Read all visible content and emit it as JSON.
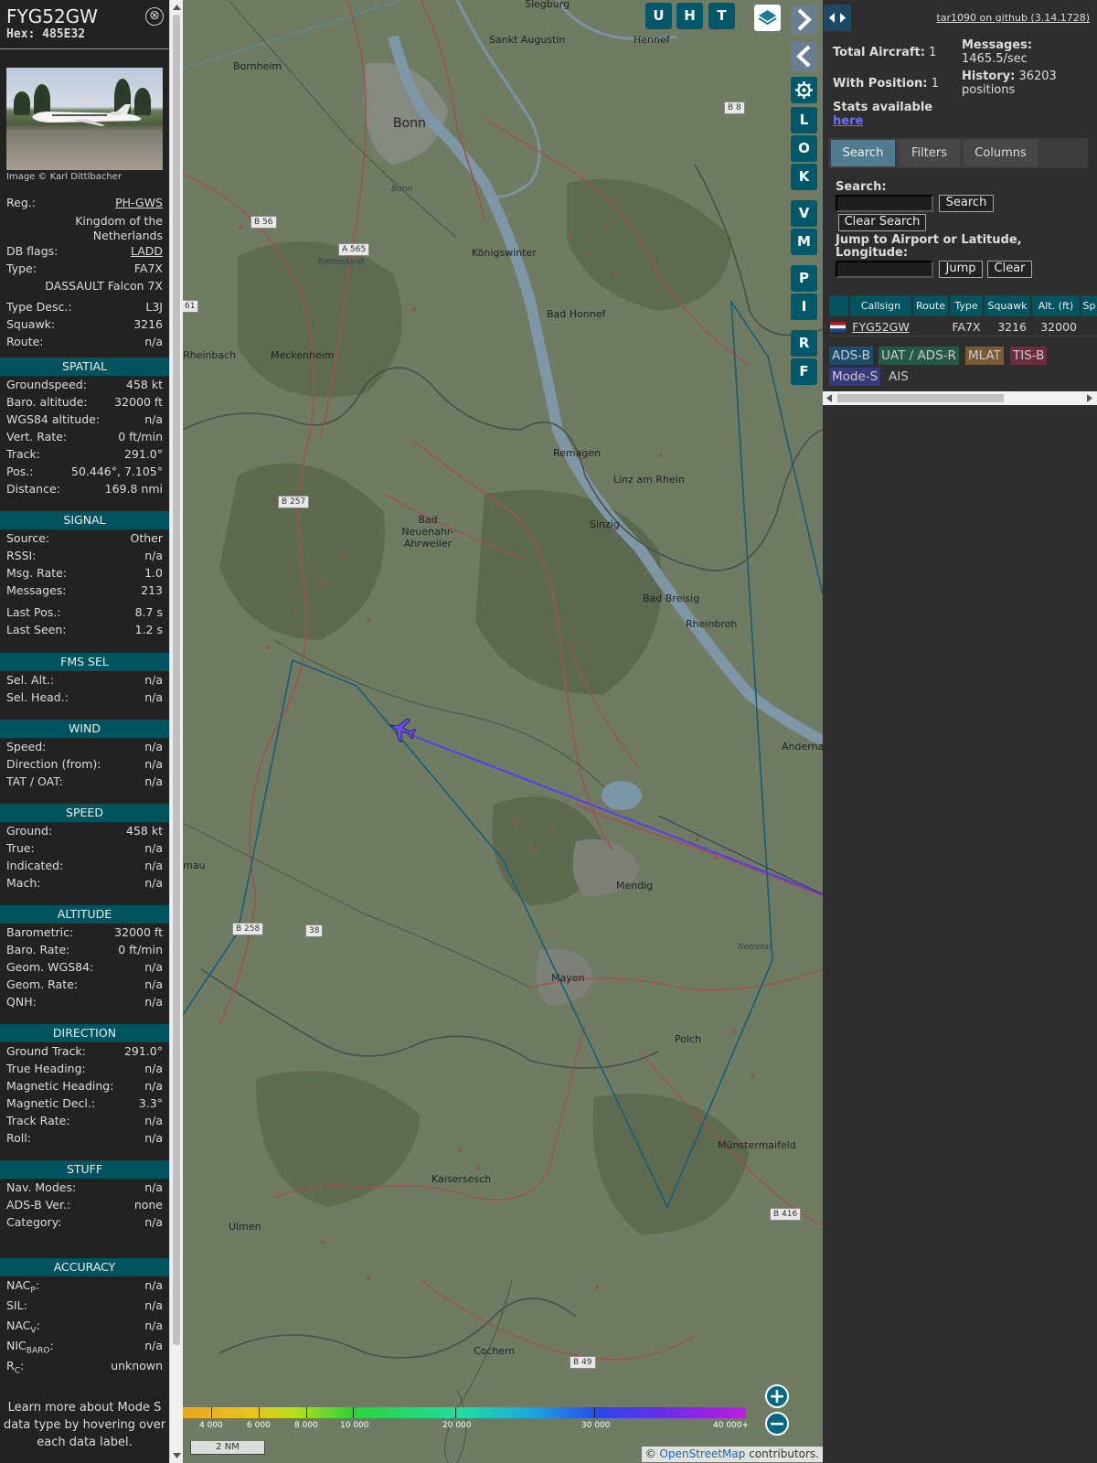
{
  "info": {
    "callsign": "FYG52GW",
    "hex": "Hex: 485E32",
    "close": "⊗",
    "photo_credit": "Image © Karl Dittlbacher",
    "reg": {
      "label": "Reg.:",
      "value": "PH-GWS",
      "country": "Kingdom of the Netherlands"
    },
    "dbflags": {
      "label": "DB flags:",
      "value": "LADD"
    },
    "type": {
      "label": "Type:",
      "value": "FA7X",
      "desc": "DASSAULT Falcon 7X"
    },
    "typedesc": {
      "label": "Type Desc.:",
      "value": "L3J"
    },
    "squawk": {
      "label": "Squawk:",
      "value": "3216"
    },
    "route": {
      "label": "Route:",
      "value": "n/a"
    },
    "sections": {
      "spatial": "SPATIAL",
      "signal": "SIGNAL",
      "fms": "FMS SEL",
      "wind": "WIND",
      "speed": "SPEED",
      "altitude": "ALTITUDE",
      "direction": "DIRECTION",
      "stuff": "STUFF",
      "accuracy": "ACCURACY"
    },
    "spatial": [
      {
        "k": "Groundspeed:",
        "v": "458 kt"
      },
      {
        "k": "Baro. altitude:",
        "v": "32000 ft"
      },
      {
        "k": "WGS84 altitude:",
        "v": "n/a"
      },
      {
        "k": "Vert. Rate:",
        "v": "0 ft/min"
      },
      {
        "k": "Track:",
        "v": "291.0°"
      },
      {
        "k": "Pos.:",
        "v": "50.446°, 7.105°"
      },
      {
        "k": "Distance:",
        "v": "169.8 nmi"
      }
    ],
    "signal": [
      {
        "k": "Source:",
        "v": "Other"
      },
      {
        "k": "RSSI:",
        "v": "n/a"
      },
      {
        "k": "Msg. Rate:",
        "v": "1.0"
      },
      {
        "k": "Messages:",
        "v": "213"
      },
      {
        "k": "Last Pos.:",
        "v": "8.7 s"
      },
      {
        "k": "Last Seen:",
        "v": "1.2 s"
      }
    ],
    "fms": [
      {
        "k": "Sel. Alt.:",
        "v": "n/a"
      },
      {
        "k": "Sel. Head.:",
        "v": "n/a"
      }
    ],
    "wind": [
      {
        "k": "Speed:",
        "v": "n/a"
      },
      {
        "k": "Direction (from):",
        "v": "n/a"
      },
      {
        "k": "TAT / OAT:",
        "v": "n/a"
      }
    ],
    "speed": [
      {
        "k": "Ground:",
        "v": "458 kt"
      },
      {
        "k": "True:",
        "v": "n/a"
      },
      {
        "k": "Indicated:",
        "v": "n/a"
      },
      {
        "k": "Mach:",
        "v": "n/a"
      }
    ],
    "altitude": [
      {
        "k": "Barometric:",
        "v": "32000 ft"
      },
      {
        "k": "Baro. Rate:",
        "v": "0 ft/min"
      },
      {
        "k": "Geom. WGS84:",
        "v": "n/a"
      },
      {
        "k": "Geom. Rate:",
        "v": "n/a"
      },
      {
        "k": "QNH:",
        "v": "n/a"
      }
    ],
    "direction": [
      {
        "k": "Ground Track:",
        "v": "291.0°"
      },
      {
        "k": "True Heading:",
        "v": "n/a"
      },
      {
        "k": "Magnetic Heading:",
        "v": "n/a"
      },
      {
        "k": "Magnetic Decl.:",
        "v": "3.3°"
      },
      {
        "k": "Track Rate:",
        "v": "n/a"
      },
      {
        "k": "Roll:",
        "v": "n/a"
      }
    ],
    "stuff": [
      {
        "k": "Nav. Modes:",
        "v": "n/a"
      },
      {
        "k": "ADS-B Ver.:",
        "v": "none"
      },
      {
        "k": "Category:",
        "v": "n/a"
      }
    ],
    "accuracy": [
      {
        "k": "NAC",
        "sub": "P",
        "v": "n/a"
      },
      {
        "k": "SIL:",
        "sub": "",
        "v": "n/a"
      },
      {
        "k": "NAC",
        "sub": "V",
        "v": "n/a"
      },
      {
        "k": "NIC",
        "sub": "BARO",
        "v": "n/a"
      },
      {
        "k": "R",
        "sub": "C",
        "v": "unknown"
      }
    ],
    "learn": "Learn more about Mode S data type by hovering over each data label."
  },
  "map": {
    "buttons": {
      "u": "U",
      "h": "H",
      "t": "T",
      "l": "L",
      "o": "O",
      "k": "K",
      "v": "V",
      "m": "M",
      "p": "P",
      "i": "I",
      "r": "R",
      "f": "F"
    },
    "zoom_in": "+",
    "zoom_out": "−",
    "scale": "2 NM",
    "altitude_labels": [
      "4 000",
      "6 000",
      "8 000",
      "10 000",
      "20 000",
      "30 000",
      "40 000+"
    ],
    "attribution": {
      "prefix": "© ",
      "link": "OpenStreetMap",
      "suffix": " contributors."
    },
    "towns": {
      "siegburg": "Siegburg",
      "sankt_augustin": "Sankt Augustin",
      "hennef": "Hennef",
      "bornheim": "Bornheim",
      "bonn": "Bonn",
      "bonn_small": "Bonn",
      "kottenforst": "Kottenforst",
      "koenigswinter": "Königswinter",
      "bad_honnef": "Bad Honnef",
      "rheinbach": "Rheinbach",
      "meckenheim": "Meckenheim",
      "remagen": "Remagen",
      "linz": "Linz am Rhein",
      "bad_neuenahr": "Bad Neuenahr-Ahrweiler",
      "sinzig": "Sinzig",
      "bad_breisig": "Bad Breisig",
      "rheinbroh": "Rheinbroh",
      "andernach": "Andernach",
      "mendig": "Mendig",
      "mayen": "Mayen",
      "nettetal": "Nettetal",
      "polch": "Polch",
      "muenstermaifeld": "Münstermaifeld",
      "kaisersesch": "Kaisersesch",
      "ulmen": "Ulmen",
      "cochem": "Cochem",
      "mau": "mau"
    },
    "roads": {
      "b8": "B 8",
      "b56": "B 56",
      "a565": "A 565",
      "b257": "B 257",
      "b258": "B 258",
      "b416": "B 416",
      "b49": "B 49",
      "r61": "61",
      "r38": "38"
    }
  },
  "side": {
    "github": "tar1090 on github (3.14.1728)",
    "total_aircraft": {
      "label": "Total Aircraft:",
      "value": "1"
    },
    "with_position": {
      "label": "With Position:",
      "value": "1"
    },
    "messages": {
      "label": "Messages:",
      "value": "1465.5/sec"
    },
    "history": {
      "label": "History:",
      "value": "36203",
      "suffix": "positions"
    },
    "stats": {
      "label": "Stats available",
      "link": "here"
    },
    "tabs": {
      "search": "Search",
      "filters": "Filters",
      "columns": "Columns"
    },
    "search_label": "Search:",
    "search_button": "Search",
    "clear_search": "Clear Search",
    "jump_label": "Jump to Airport or Latitude, Longitude:",
    "jump_button": "Jump",
    "clear_button": "Clear",
    "table": {
      "headers": [
        "",
        "Callsign",
        "Route",
        "Type",
        "Squawk",
        "Alt. (ft)",
        "Sp"
      ],
      "rows": [
        {
          "callsign": "FYG52GW",
          "route": "",
          "type": "FA7X",
          "squawk": "3216",
          "alt": "32000"
        }
      ]
    },
    "legend": [
      "ADS-B",
      "UAT / ADS-R",
      "MLAT",
      "TIS-B",
      "Mode-S",
      "AIS"
    ],
    "legend_colors": {
      "adsb": "#1b4d6b",
      "uat": "#245a45",
      "mlat": "#7a5a32",
      "tisb": "#6e2d3f",
      "modes": "#373a7a",
      "ais": "#2e2e2e"
    }
  }
}
